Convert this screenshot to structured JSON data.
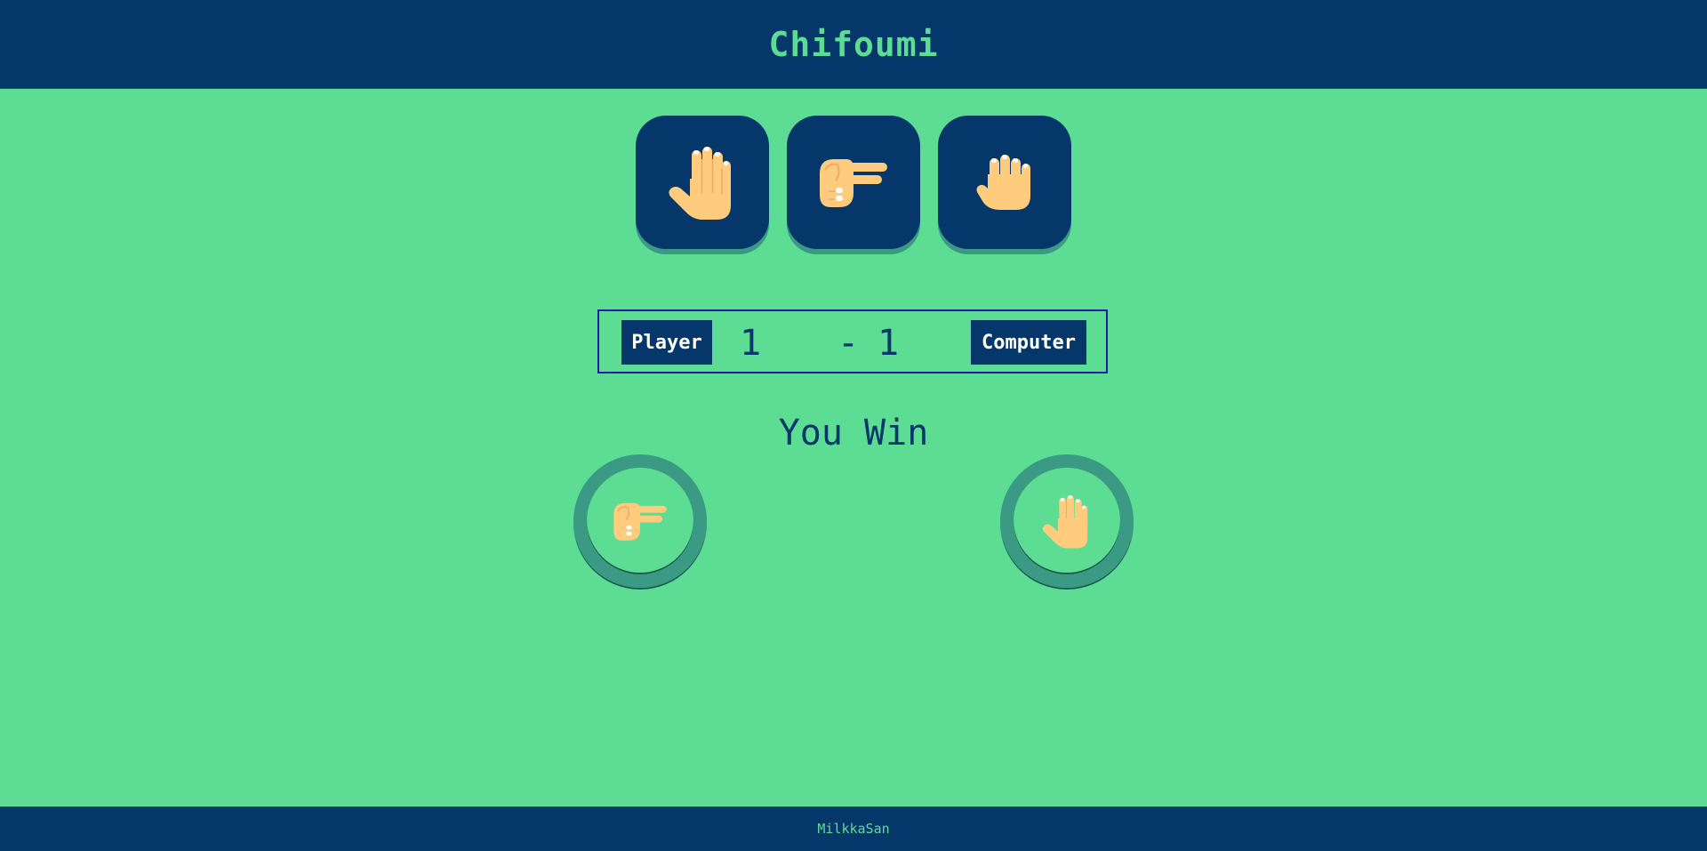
{
  "header": {
    "title": "Chifoumi"
  },
  "choices": [
    {
      "name": "paper",
      "icon": "paper-hand-icon"
    },
    {
      "name": "scissors",
      "icon": "scissors-hand-icon"
    },
    {
      "name": "rock",
      "icon": "rock-fist-icon"
    }
  ],
  "scoreboard": {
    "player_label": "Player",
    "computer_label": "Computer",
    "player_score": "1",
    "separator": "-",
    "computer_score": "1"
  },
  "result": {
    "text": "You Win"
  },
  "picks": {
    "player_icon": "scissors-hand-icon",
    "computer_icon": "paper-hand-icon"
  },
  "footer": {
    "text": "MilkkaSan"
  },
  "colors": {
    "background": "#5ddc94",
    "navy": "#05376b",
    "teal_ring": "#3a9a83",
    "skin": "#ffcb7c"
  }
}
